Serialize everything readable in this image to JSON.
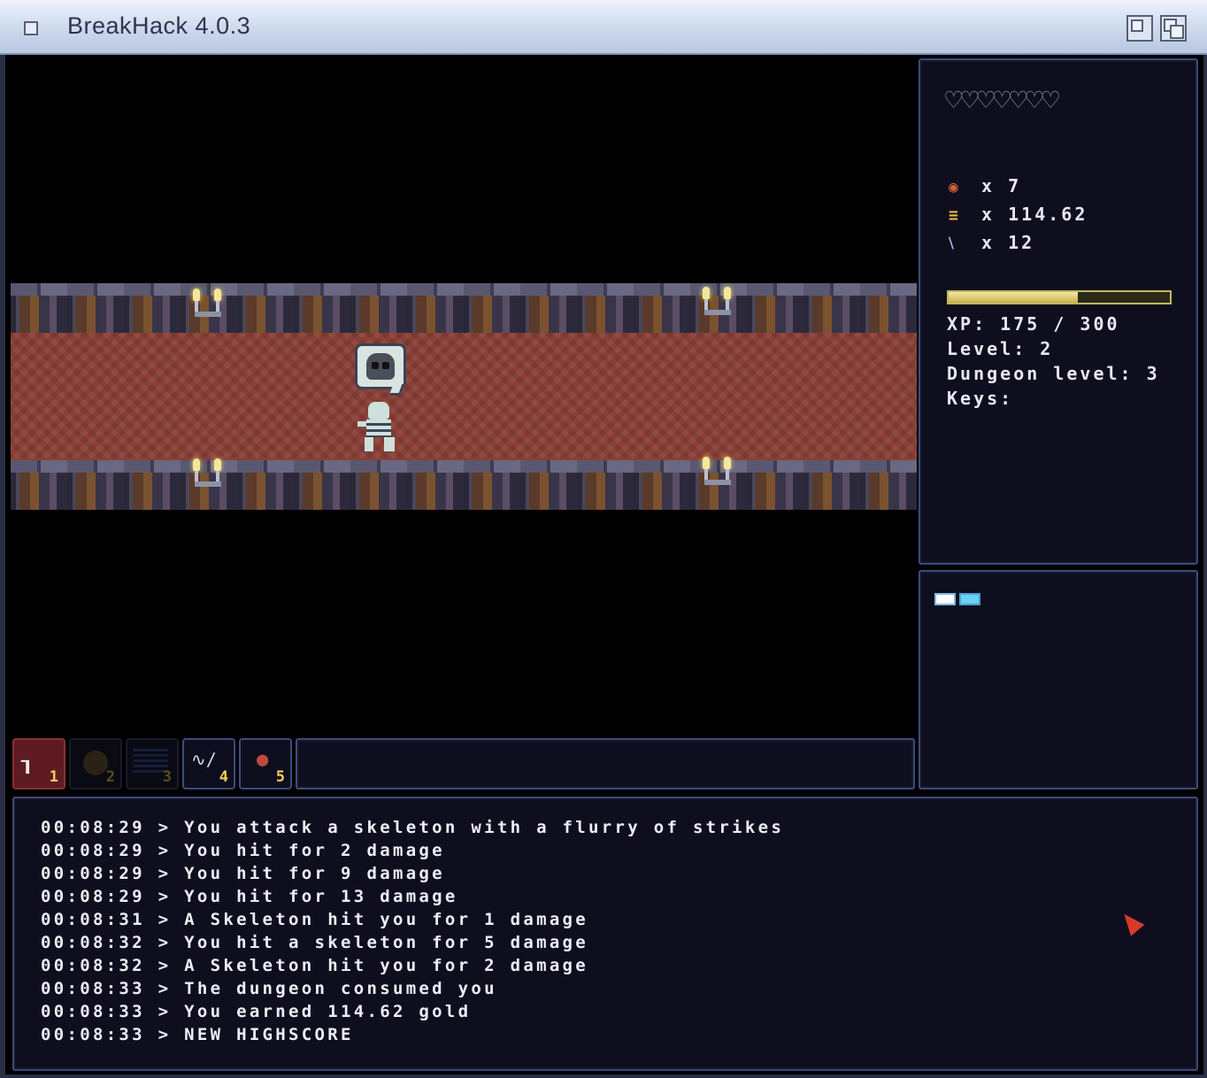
{
  "window": {
    "title": "BreakHack 4.0.3"
  },
  "hotbar": {
    "slots": [
      {
        "num": "1",
        "icon": "weapon-swing-icon",
        "glyph": "┒"
      },
      {
        "num": "2",
        "icon": "shield-icon",
        "glyph": ""
      },
      {
        "num": "3",
        "icon": "scroll-icon",
        "glyph": ""
      },
      {
        "num": "4",
        "icon": "whip-dagger-icon",
        "glyph": "∿∕"
      },
      {
        "num": "5",
        "icon": "bomb-icon",
        "glyph": "●"
      }
    ]
  },
  "status": {
    "hearts": "♡♡♡♡♡♡♡",
    "bombs": "x 7",
    "gold": "x 114.62",
    "daggers": "x 12",
    "xp_progress": 0.5833,
    "xp_text": "XP: 175 / 300",
    "level_text": "Level: 2",
    "dungeon_level_text": "Dungeon level: 3",
    "keys_text": "Keys:"
  },
  "colors": {
    "panel_border": "#3d4a7a",
    "active_slot": "#5e1c22",
    "xp_bar": "#c8b050",
    "cursor": "#d83a2a"
  },
  "log": [
    "00:08:29 > You attack a skeleton with a flurry of strikes",
    "00:08:29 > You hit for 2 damage",
    "00:08:29 > You hit for 9 damage",
    "00:08:29 > You hit for 13 damage",
    "00:08:31 > A Skeleton hit you for 1 damage",
    "00:08:32 > You hit a skeleton for 5 damage",
    "00:08:32 > A Skeleton hit you for 2 damage",
    "00:08:33 > The dungeon consumed you",
    "00:08:33 > You earned 114.62 gold",
    "00:08:33 > NEW HIGHSCORE"
  ]
}
